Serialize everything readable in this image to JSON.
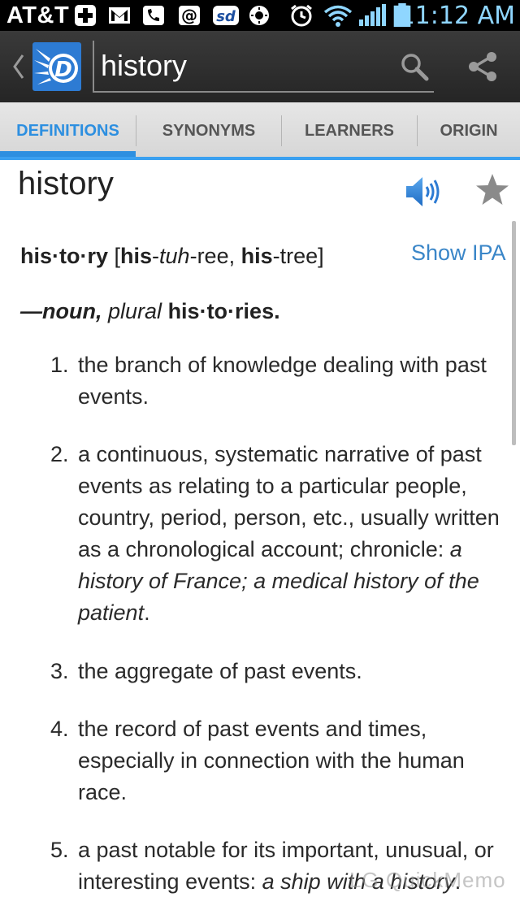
{
  "status_bar": {
    "carrier": "AT&T",
    "time": "11:12 AM",
    "icons": [
      "plus-icon",
      "gmail-icon",
      "voicemail-icon",
      "at-email-icon",
      "sd-icon",
      "sun-icon",
      "alarm-icon",
      "wifi-icon",
      "signal-icon",
      "battery-icon"
    ]
  },
  "action_bar": {
    "logo": "dictionary-logo-icon",
    "search_value": "history",
    "search_icon": "search-icon",
    "share_icon": "share-icon"
  },
  "tabs": [
    {
      "label": "DEFINITIONS",
      "active": true
    },
    {
      "label": "SYNONYMS",
      "active": false
    },
    {
      "label": "LEARNERS",
      "active": false
    },
    {
      "label": "ORIGIN",
      "active": false
    }
  ],
  "colors": {
    "accent": "#2d8fe0",
    "link": "#3a86c8",
    "clock": "#8fd6ff"
  },
  "entry": {
    "headword": "history",
    "pronunciation": {
      "syllabified": "his·to·ry",
      "open_bracket": " [",
      "p1_bold": "his",
      "p1_sep": "-",
      "p1_ital": "tuh",
      "p1_rest": "-ree, ",
      "p2_bold": "his",
      "p2_rest": "-tree]"
    },
    "show_ipa": "Show IPA",
    "part_of_speech": {
      "dash_pos": "—noun,",
      "plural_label": "plural",
      "plural_form": "his·to·ries."
    },
    "definitions": [
      {
        "num": "1.",
        "text": "the branch of knowledge dealing with past events."
      },
      {
        "num": "2.",
        "text": "a continuous, systematic narrative of past events as relating to a particular people, country, period, person, etc., usually written as a chronological account; chronicle: ",
        "example": "a history of France; a medical history of the patient",
        "end": "."
      },
      {
        "num": "3.",
        "text": "the aggregate of past events."
      },
      {
        "num": "4.",
        "text": "the record of past events and times, especially in connection with the human race."
      },
      {
        "num": "5.",
        "text": "a past notable for its important, unusual, or interesting events: ",
        "example": "a ship with a history",
        "end": "."
      }
    ]
  },
  "watermark": "LG QuickMemo"
}
